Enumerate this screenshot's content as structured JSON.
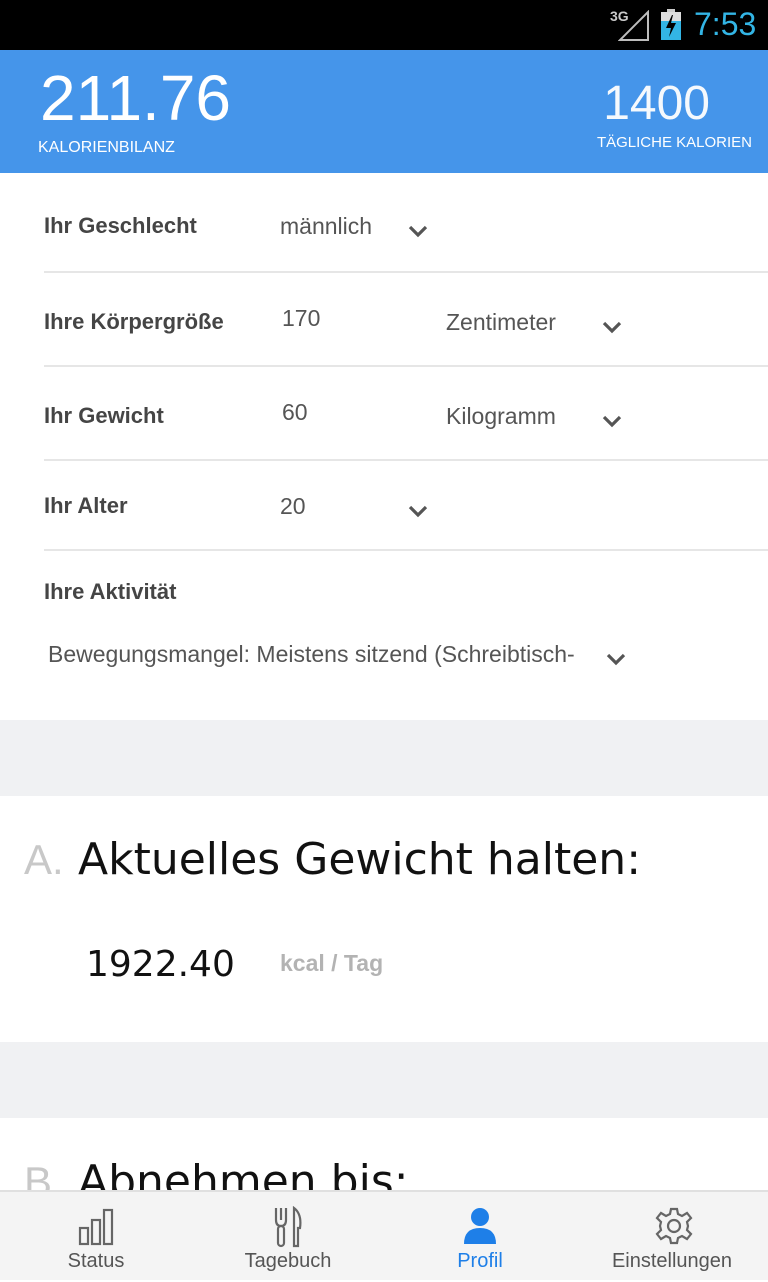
{
  "status_bar": {
    "network": "3G",
    "time": "7:53"
  },
  "header": {
    "balance_value": "211.76",
    "balance_label": "KALORIENBILANZ",
    "daily_value": "1400",
    "daily_label": "TÄGLICHE KALORIEN",
    "accent_color": "#4595ea"
  },
  "profile": {
    "gender": {
      "label": "Ihr Geschlecht",
      "value": "männlich"
    },
    "height": {
      "label": "Ihre Körpergröße",
      "value": "170",
      "unit": "Zentimeter"
    },
    "weight": {
      "label": "Ihr Gewicht",
      "value": "60",
      "unit": "Kilogramm"
    },
    "age": {
      "label": "Ihr Alter",
      "value": "20"
    },
    "activity": {
      "label": "Ihre Aktivität",
      "value": "Bewegungsmangel: Meistens sitzend (Schreibtisch-"
    }
  },
  "sections": {
    "a": {
      "letter": "A.",
      "title": "Aktuelles Gewicht halten:",
      "value": "1922.40",
      "unit": "kcal / Tag"
    },
    "b": {
      "letter": "B.",
      "title": "Abnehmen bis:"
    }
  },
  "tabs": [
    {
      "label": "Status",
      "icon": "bar-chart-icon"
    },
    {
      "label": "Tagebuch",
      "icon": "cutlery-icon"
    },
    {
      "label": "Profil",
      "icon": "person-icon",
      "active": true
    },
    {
      "label": "Einstellungen",
      "icon": "gear-icon"
    }
  ]
}
